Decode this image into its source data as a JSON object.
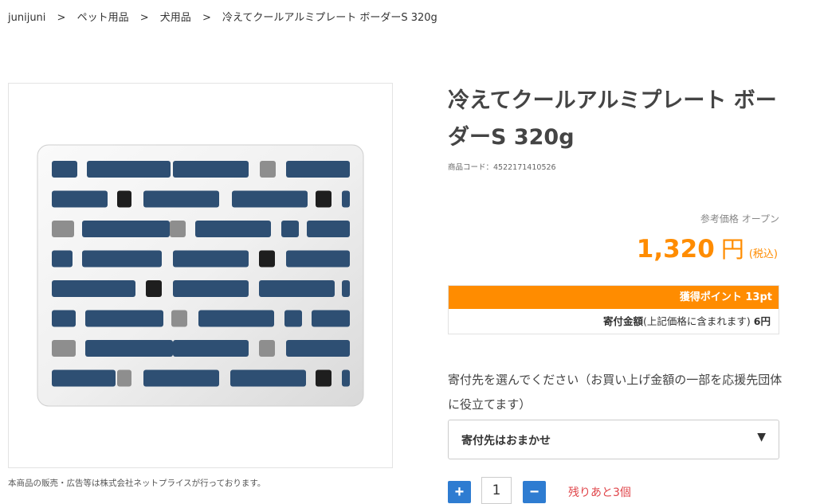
{
  "breadcrumb": {
    "items": [
      "junijuni",
      "ペット用品",
      "犬用品",
      "冷えてクールアルミプレート ボーダーS 320g"
    ],
    "separator": ">"
  },
  "product": {
    "title": "冷えてクールアルミプレート ボーダーS 320g",
    "code_label": "商品コード：4522171410526",
    "image_caption": "本商品の販売・広告等は株式会社ネットプライスが行っております。"
  },
  "price": {
    "reference": "参考価格 オープン",
    "amount": "1,320",
    "currency": "円",
    "tax_note": "(税込)"
  },
  "points": {
    "earned": "獲得ポイント 13pt",
    "donation_label": "寄付金額",
    "donation_note": "(上記価格に含まれます)",
    "donation_value": "6円"
  },
  "donation_select": {
    "prompt": "寄付先を選んでください（お買い上げ金額の一部を応援先団体に役立てます）",
    "selected": "寄付先はおまかせ",
    "caret": "▼"
  },
  "quantity": {
    "plus": "+",
    "value": "1",
    "minus": "−",
    "stock": "残りあと3個"
  },
  "colors": {
    "accent": "#ff8c00",
    "button": "#2e7cd1",
    "stock": "#e0454a",
    "plate_blue": "#2e4f73"
  }
}
